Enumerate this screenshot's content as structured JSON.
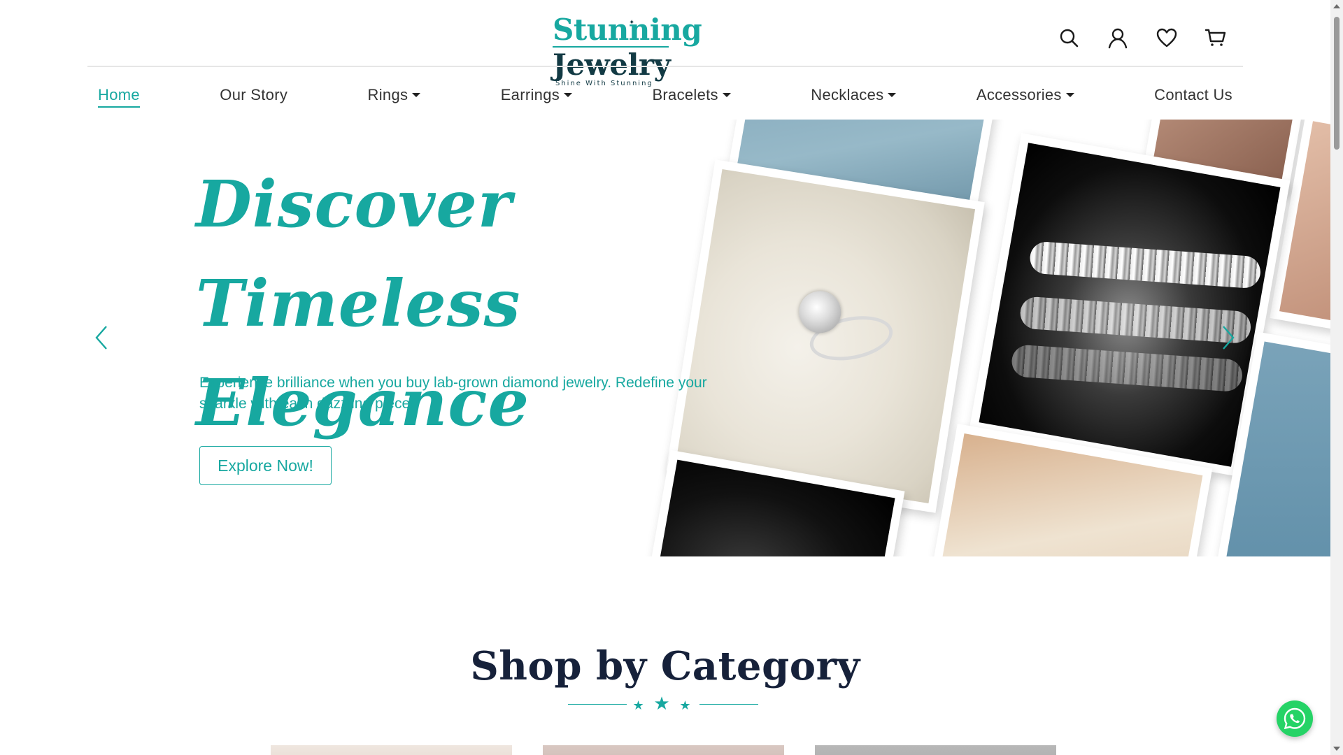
{
  "brand": {
    "name_part1": "Stunning",
    "name_part2": "Jewelry",
    "tagline": "Shine With Stunning"
  },
  "header": {
    "icons": [
      "search-icon",
      "user-icon",
      "heart-icon",
      "cart-icon"
    ]
  },
  "nav": {
    "items": [
      {
        "label": "Home",
        "active": true,
        "dropdown": false
      },
      {
        "label": "Our Story",
        "active": false,
        "dropdown": false
      },
      {
        "label": "Rings",
        "active": false,
        "dropdown": true
      },
      {
        "label": "Earrings",
        "active": false,
        "dropdown": true
      },
      {
        "label": "Bracelets",
        "active": false,
        "dropdown": true
      },
      {
        "label": "Necklaces",
        "active": false,
        "dropdown": true
      },
      {
        "label": "Accessories",
        "active": false,
        "dropdown": true
      },
      {
        "label": "Contact Us",
        "active": false,
        "dropdown": false
      }
    ]
  },
  "hero": {
    "title_line1": "Discover Timeless",
    "title_line2": "Elegance",
    "description": "Experience brilliance when you buy lab-grown diamond jewelry. Redefine your sparkle with each dazzling piece!",
    "button_label": "Explore Now!"
  },
  "category_section": {
    "title": "Shop by Category",
    "divider_stars": "★ ★ ★"
  },
  "colors": {
    "accent": "#17a8a0",
    "heading": "#16213a",
    "logo_dark": "#123a44",
    "whatsapp": "#25d366"
  }
}
